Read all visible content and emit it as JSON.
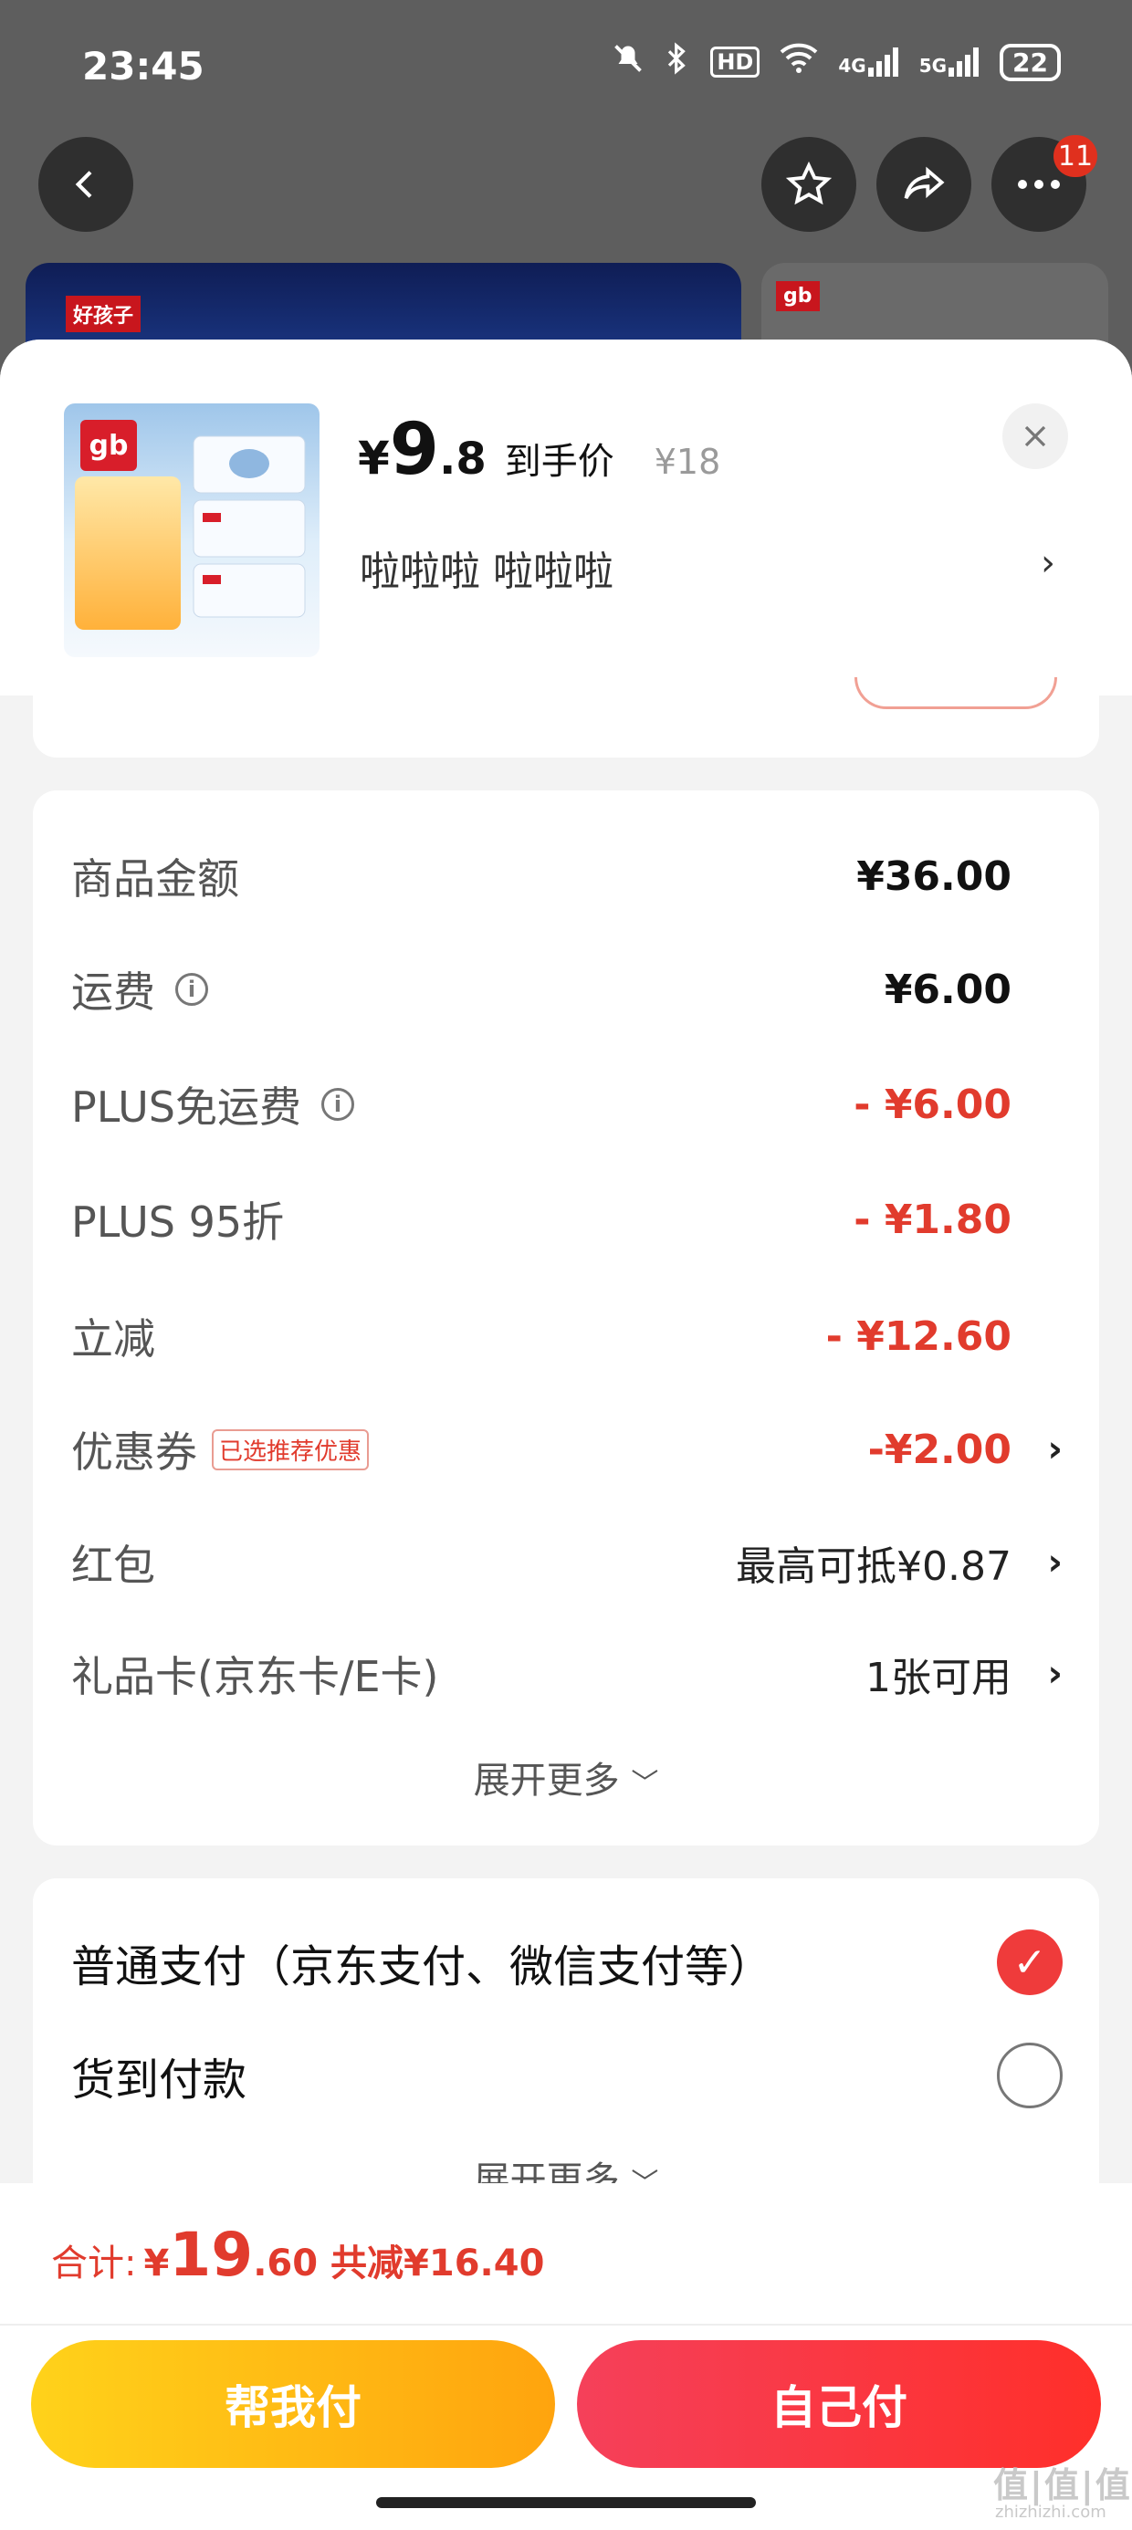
{
  "status_bar": {
    "time": "23:45",
    "hd": "HD",
    "net1": "4G",
    "net2": "5G",
    "battery": "22"
  },
  "header": {
    "more_badge": "11"
  },
  "banners": {
    "brand_tag": "好孩子",
    "brand_tag2": "gb"
  },
  "product": {
    "thumb_logo": "gb",
    "price_currency": "¥",
    "price_int": "9",
    "price_dec": ".8",
    "price_label": "到手价",
    "original_price": "¥18",
    "variant": "啦啦啦  啦啦啦"
  },
  "price_details": {
    "rows": [
      {
        "label": "商品金额",
        "value": "¥36.00"
      },
      {
        "label": "运费",
        "value": "¥6.00"
      },
      {
        "label": "PLUS免运费",
        "value": "- ¥6.00"
      },
      {
        "label": "PLUS 95折",
        "value": "- ¥1.80"
      },
      {
        "label": "立减",
        "value": "- ¥12.60"
      },
      {
        "label": "优惠券",
        "tag": "已选推荐优惠",
        "value": "-¥2.00"
      },
      {
        "label": "红包",
        "value": "最高可抵¥0.87"
      },
      {
        "label": "礼品卡(京东卡/E卡)",
        "value": "1张可用"
      }
    ],
    "expand": "展开更多"
  },
  "payment": {
    "options": [
      {
        "label": "普通支付（京东支付、微信支付等）",
        "selected": true
      },
      {
        "label": "货到付款",
        "selected": false
      }
    ],
    "expand": "展开更多"
  },
  "footer": {
    "total_label": "合计:",
    "total_currency": "¥",
    "total_int": "19",
    "total_dec": ".60",
    "savings": "共减¥16.40",
    "help_pay": "帮我付",
    "self_pay": "自己付"
  },
  "watermark": {
    "main": "值|值|值",
    "sub": "zhizhizhi.com"
  },
  "colors": {
    "accent_red": "#e13b2d",
    "help_btn": "#ffb512",
    "self_btn": "#f53a45"
  }
}
